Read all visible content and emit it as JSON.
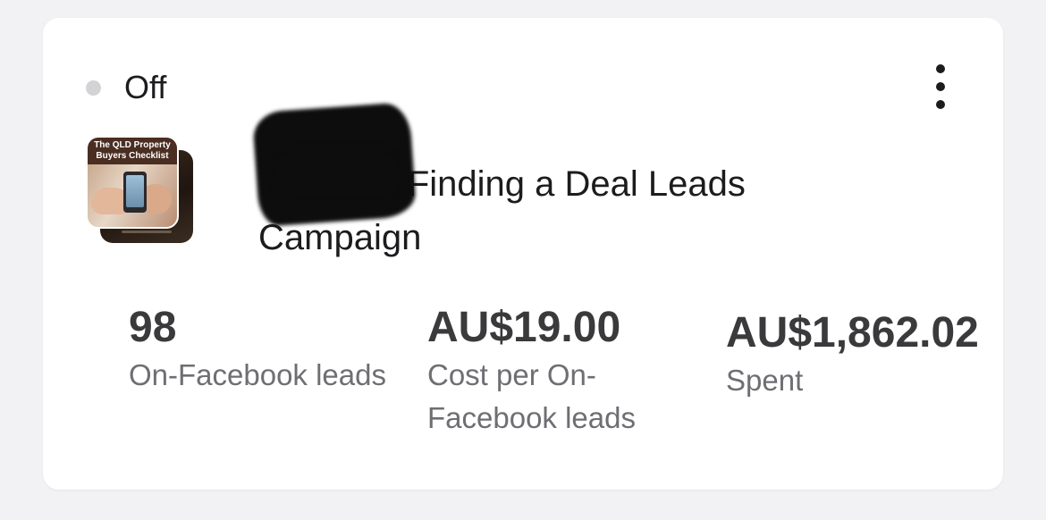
{
  "status": {
    "label": "Off",
    "dot_color": "#d3d3d6"
  },
  "menu": {
    "icon": "more-vertical-icon"
  },
  "campaign": {
    "thumbnail_title": "The QLD Property Buyers Checklist",
    "name": "14/10/22 Finding a Deal Leads Campaign"
  },
  "metrics": [
    {
      "value": "98",
      "label": "On-Facebook leads"
    },
    {
      "value": "AU$19.00",
      "label": "Cost per On-Facebook leads"
    },
    {
      "value": "AU$1,862.02",
      "label": "Spent"
    }
  ]
}
